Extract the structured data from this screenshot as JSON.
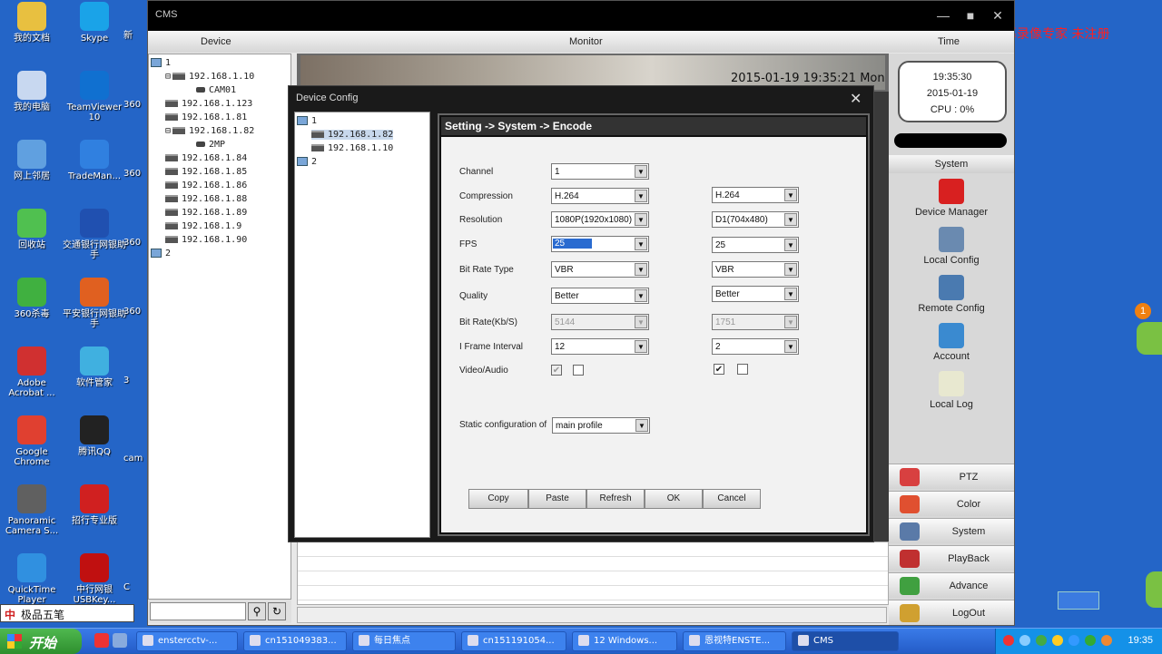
{
  "desktop": {
    "watermark": "屏幕录像专家 未注册",
    "badge": "1",
    "col1": [
      {
        "label": "我的文档",
        "color": "#e8c040"
      },
      {
        "label": "我的电脑",
        "color": "#c8d8f0"
      },
      {
        "label": "网上邻居",
        "color": "#60a0e0"
      },
      {
        "label": "回收站",
        "color": "#50c050"
      },
      {
        "label": "360杀毒",
        "color": "#40b040"
      },
      {
        "label": "Adobe Acrobat ...",
        "color": "#d03030"
      },
      {
        "label": "Google Chrome",
        "color": "#e04030"
      },
      {
        "label": "Panoramic Camera S...",
        "color": "#606060"
      },
      {
        "label": "QuickTime Player",
        "color": "#3090e0"
      }
    ],
    "col2": [
      {
        "label": "Skype",
        "color": "#1aa3e8"
      },
      {
        "label": "TeamViewer 10",
        "color": "#1070d0"
      },
      {
        "label": "TradeMan...",
        "color": "#3080e0"
      },
      {
        "label": "交通银行网银助手",
        "color": "#2050b0"
      },
      {
        "label": "平安银行网银助手",
        "color": "#e06020"
      },
      {
        "label": "软件管家",
        "color": "#40b0e0"
      },
      {
        "label": "腾讯QQ",
        "color": "#222222"
      },
      {
        "label": "招行专业版",
        "color": "#d02020"
      },
      {
        "label": "中行网银USBKey...",
        "color": "#c01010"
      }
    ],
    "col3": [
      "新",
      "360",
      "360",
      "360",
      "360",
      "3",
      "cam",
      "C"
    ]
  },
  "cms": {
    "title": "CMS",
    "min": "—",
    "max": "■",
    "close": "✕",
    "header": {
      "device": "Device",
      "monitor": "Monitor",
      "time": "Time"
    },
    "tree": [
      {
        "type": "group",
        "label": "1",
        "indent": 0
      },
      {
        "type": "dvr",
        "label": "192.168.1.10",
        "indent": 1,
        "expander": "⊟"
      },
      {
        "type": "cam",
        "label": "CAM01",
        "indent": 2
      },
      {
        "type": "dvr",
        "label": "192.168.1.123",
        "indent": 1
      },
      {
        "type": "dvr",
        "label": "192.168.1.81",
        "indent": 1
      },
      {
        "type": "dvr",
        "label": "192.168.1.82",
        "indent": 1,
        "expander": "⊟"
      },
      {
        "type": "cam",
        "label": "2MP",
        "indent": 2
      },
      {
        "type": "dvr",
        "label": "192.168.1.84",
        "indent": 1
      },
      {
        "type": "dvr",
        "label": "192.168.1.85",
        "indent": 1
      },
      {
        "type": "dvr",
        "label": "192.168.1.86",
        "indent": 1
      },
      {
        "type": "dvr",
        "label": "192.168.1.88",
        "indent": 1
      },
      {
        "type": "dvr",
        "label": "192.168.1.89",
        "indent": 1
      },
      {
        "type": "dvr",
        "label": "192.168.1.9",
        "indent": 1
      },
      {
        "type": "dvr",
        "label": "192.168.1.90",
        "indent": 1
      },
      {
        "type": "group",
        "label": "2",
        "indent": 0
      }
    ],
    "osd_time": "2015-01-19 19:35:21 Mon",
    "clock": {
      "time": "19:35:30",
      "date": "2015-01-19",
      "cpu": "CPU : 0%"
    },
    "panel_title": "System",
    "panel_items": [
      {
        "name": "device-manager",
        "label": "Device Manager",
        "color": "#d82020"
      },
      {
        "name": "local-config",
        "label": "Local Config",
        "color": "#6a8ab0"
      },
      {
        "name": "remote-config",
        "label": "Remote Config",
        "color": "#4a7ab0"
      },
      {
        "name": "account",
        "label": "Account",
        "color": "#3a8ad0"
      },
      {
        "name": "local-log",
        "label": "Local Log",
        "color": "#e8e8d0"
      }
    ],
    "nav": [
      {
        "name": "ptz",
        "label": "PTZ",
        "color": "#d84040"
      },
      {
        "name": "color",
        "label": "Color",
        "color": "#e05030"
      },
      {
        "name": "system",
        "label": "System",
        "color": "#5a7aa8"
      },
      {
        "name": "playback",
        "label": "PlayBack",
        "color": "#c03030"
      },
      {
        "name": "advance",
        "label": "Advance",
        "color": "#40a040"
      },
      {
        "name": "logout",
        "label": "LogOut",
        "color": "#d0a030"
      }
    ]
  },
  "dialog": {
    "title": "Device Config",
    "close": "✕",
    "tree": [
      {
        "label": "1",
        "type": "group",
        "indent": 0
      },
      {
        "label": "192.168.1.82",
        "type": "dvr",
        "indent": 1,
        "selected": true
      },
      {
        "label": "192.168.1.10",
        "type": "dvr",
        "indent": 1
      },
      {
        "label": "2",
        "type": "group",
        "indent": 0
      }
    ],
    "header": "Setting -> System -> Encode",
    "labels": {
      "channel": "Channel",
      "compression": "Compression",
      "resolution": "Resolution",
      "fps": "FPS",
      "bitrate_type": "Bit Rate Type",
      "quality": "Quality",
      "bitrate": "Bit Rate(Kb/S)",
      "iframe": "I Frame Interval",
      "video_audio": "Video/Audio",
      "static_config": "Static configuration of"
    },
    "main": {
      "channel": "1",
      "compression": "H.264",
      "resolution": "1080P(1920x1080)",
      "fps": "25",
      "bitrate_type": "VBR",
      "quality": "Better",
      "bitrate": "5144",
      "iframe": "12",
      "video": "✔",
      "audio": ""
    },
    "extra": {
      "compression": "H.264",
      "resolution": "D1(704x480)",
      "fps": "25",
      "bitrate_type": "VBR",
      "quality": "Better",
      "bitrate": "1751",
      "iframe": "2",
      "video": "✔",
      "audio": ""
    },
    "static_config_value": "main profile",
    "buttons": {
      "copy": "Copy",
      "paste": "Paste",
      "refresh": "Refresh",
      "ok": "OK",
      "cancel": "Cancel"
    }
  },
  "taskbar": {
    "ime": {
      "zh": "中",
      "label": "极品五笔"
    },
    "start": "开始",
    "tasks": [
      {
        "label": "enstercctv-...",
        "active": false
      },
      {
        "label": "cn151049383...",
        "active": false
      },
      {
        "label": "每日焦点",
        "active": false
      },
      {
        "label": "cn151191054...",
        "active": false
      },
      {
        "label": "12 Windows...",
        "active": false
      },
      {
        "label": "恩视特ENSTE...",
        "active": false
      },
      {
        "label": "CMS",
        "active": true
      }
    ],
    "clock": "19:35"
  }
}
